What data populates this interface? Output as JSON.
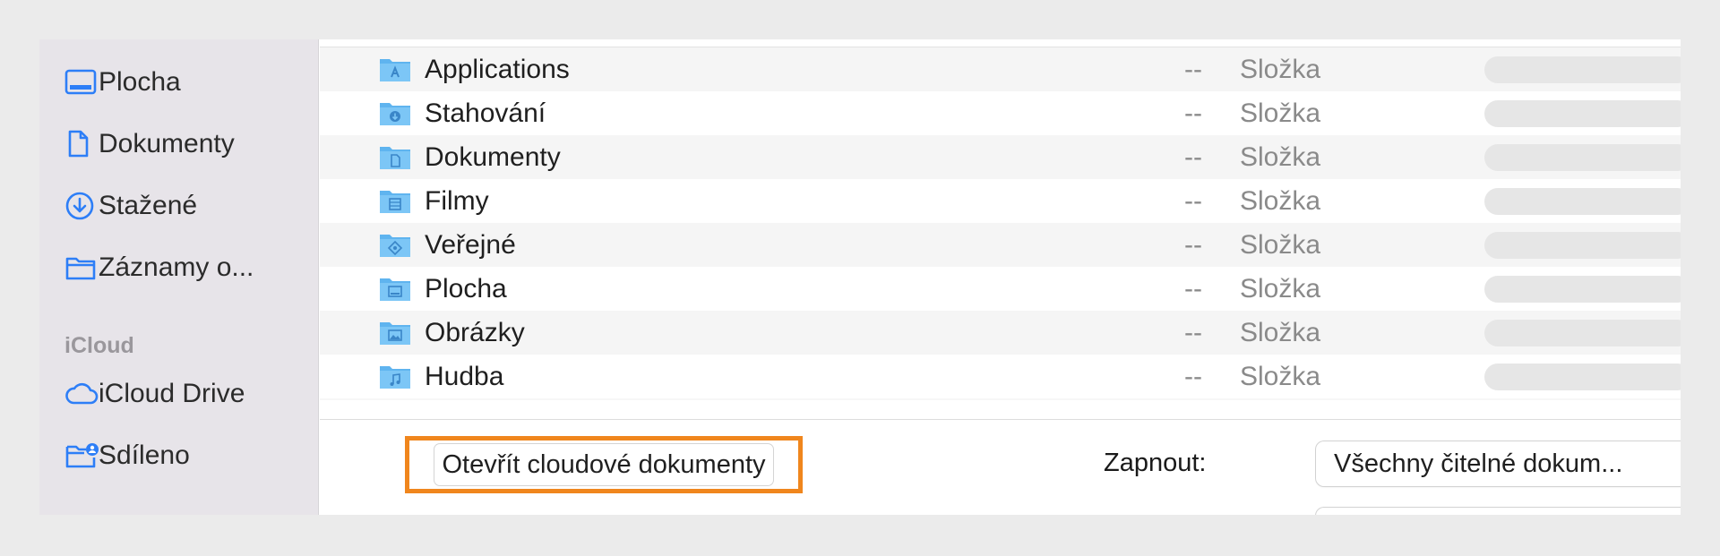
{
  "sidebar": {
    "items": [
      {
        "label": "Plocha",
        "icon": "desktop-icon"
      },
      {
        "label": "Dokumenty",
        "icon": "document-icon"
      },
      {
        "label": "Stažené",
        "icon": "download-icon"
      },
      {
        "label": "Záznamy o...",
        "icon": "folder-icon"
      }
    ],
    "icloud_heading": "iCloud",
    "icloud_items": [
      {
        "label": "iCloud Drive",
        "icon": "cloud-icon"
      },
      {
        "label": "Sdíleno",
        "icon": "shared-folder-icon"
      }
    ]
  },
  "files": [
    {
      "name": "Applications",
      "size": "--",
      "kind": "Složka",
      "icon": "applications-folder-icon"
    },
    {
      "name": "Stahování",
      "size": "--",
      "kind": "Složka",
      "icon": "downloads-folder-icon"
    },
    {
      "name": "Dokumenty",
      "size": "--",
      "kind": "Složka",
      "icon": "documents-folder-icon"
    },
    {
      "name": "Filmy",
      "size": "--",
      "kind": "Složka",
      "icon": "movies-folder-icon"
    },
    {
      "name": "Veřejné",
      "size": "--",
      "kind": "Složka",
      "icon": "public-folder-icon"
    },
    {
      "name": "Plocha",
      "size": "--",
      "kind": "Složka",
      "icon": "desktop-folder-icon"
    },
    {
      "name": "Obrázky",
      "size": "--",
      "kind": "Složka",
      "icon": "pictures-folder-icon"
    },
    {
      "name": "Hudba",
      "size": "--",
      "kind": "Složka",
      "icon": "music-folder-icon"
    }
  ],
  "footer": {
    "open_cloud_button": "Otevřít cloudové dokumenty",
    "enable_label": "Zapnout:",
    "enable_value": "Všechny čitelné dokum..."
  },
  "colors": {
    "accent": "#2d7ef7",
    "highlight": "#f0861d",
    "sidebar_bg": "#e7e4e9"
  }
}
